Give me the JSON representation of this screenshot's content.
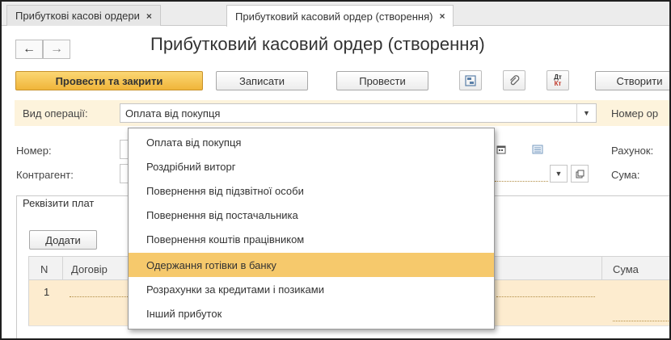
{
  "tabs": [
    {
      "label": "Прибуткові касові ордери",
      "close": "×"
    },
    {
      "label": "Прибутковий касовий ордер (створення)",
      "close": "×"
    }
  ],
  "nav": {
    "back": "←",
    "forward": "→"
  },
  "page": {
    "title": "Прибутковий касовий ордер (створення)"
  },
  "toolbar": {
    "post_close": "Провести та закрити",
    "save": "Записати",
    "post": "Провести",
    "create": "Створити",
    "dtkt_top": "Дт",
    "dtkt_bottom": "Кт"
  },
  "form": {
    "operation_label": "Вид операції:",
    "operation_value": "Оплата від покупця",
    "number_op_label": "Номер ор",
    "number_label": "Номер:",
    "account_label": "Рахунок:",
    "counterparty_label": "Контрагент:",
    "sum_label": "Сума:"
  },
  "panel": {
    "tab_label": "Реквізити плат",
    "add_button": "Додати",
    "columns": {
      "n": "N",
      "contract": "Договір",
      "sum": "Сума"
    },
    "rows": [
      {
        "n": "1"
      }
    ]
  },
  "dropdown": {
    "items": [
      "Оплата від покупця",
      "Роздрібний виторг",
      "Повернення від підзвітної особи",
      "Повернення від постачальника",
      "Повернення коштів працівником",
      "Одержання готівки в банку",
      "Розрахунки за кредитами і позиками",
      "Інший прибуток"
    ],
    "highlighted_index": 5
  },
  "colors": {
    "accent": "#f0b53a",
    "highlight": "#f6c96c",
    "row_selected": "#fdeccf"
  }
}
